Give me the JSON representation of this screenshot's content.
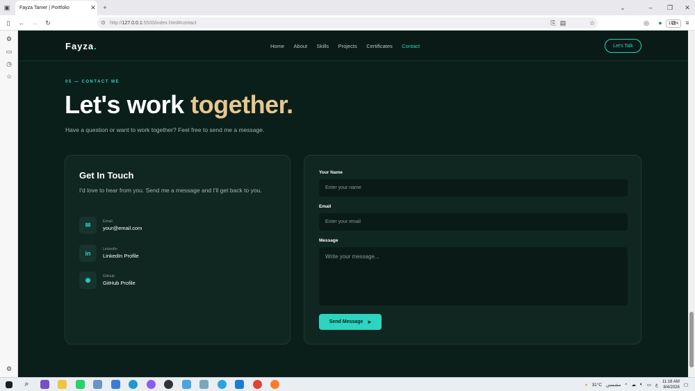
{
  "browser": {
    "tab_title": "Fayza Tamer | Portfolio",
    "url_prefix": "http://",
    "url_host": "127.0.0.1",
    "url_rest": ":5500/index.html#contact",
    "zoom": "110%"
  },
  "site": {
    "logo": "Fayza",
    "logo_dot": ".",
    "nav": [
      "Home",
      "About",
      "Skills",
      "Projects",
      "Certificates",
      "Contact"
    ],
    "active_nav": "Contact",
    "cta": "Let's Talk"
  },
  "hero": {
    "eyebrow": "05 — CONTACT ME",
    "headline_plain": "Let's work ",
    "headline_accent": "together.",
    "subtitle": "Have a question or want to work together? Feel free to send me a message."
  },
  "contact_card": {
    "title": "Get In Touch",
    "text": "I'd love to hear from you. Send me a message and I'll get back to you.",
    "items": [
      {
        "label": "Email",
        "value": "your@email.com",
        "icon": "mail-icon",
        "glyph": "✉"
      },
      {
        "label": "LinkedIn",
        "value": "LinkedIn Profile",
        "icon": "linkedin-icon",
        "glyph": "in"
      },
      {
        "label": "GitHub",
        "value": "GitHub Profile",
        "icon": "github-icon",
        "glyph": "◉"
      }
    ]
  },
  "form": {
    "name_label": "Your Name",
    "name_placeholder": "Enter your name",
    "email_label": "Email",
    "email_placeholder": "Enter your email",
    "message_label": "Message",
    "message_placeholder": "Write your message...",
    "submit": "Send Message"
  },
  "taskbar": {
    "weather": "31°C",
    "weather_text": "مشمس",
    "time": "11:18 AM",
    "date": "8/4/2026",
    "lang": "ع"
  },
  "colors": {
    "accent": "#2dd4bf",
    "accent_gold": "#e6c78e",
    "background": "#0b1f1a"
  }
}
